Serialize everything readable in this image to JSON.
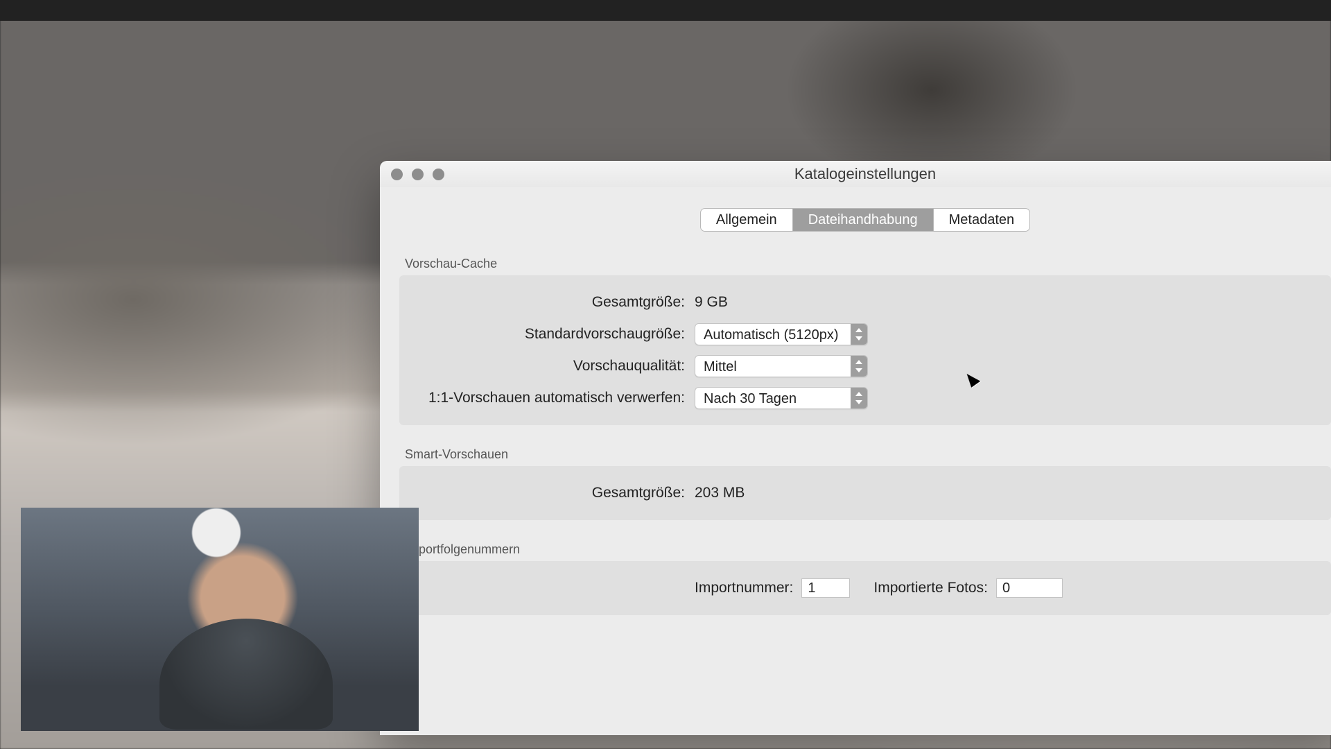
{
  "window": {
    "title": "Katalogeinstellungen"
  },
  "tabs": {
    "general": "Allgemein",
    "file": "Dateihandhabung",
    "metadata": "Metadaten",
    "active": "file"
  },
  "preview_cache": {
    "section_label": "Vorschau-Cache",
    "total_size_label": "Gesamtgröße:",
    "total_size_value": "9 GB",
    "default_size_label": "Standardvorschaugröße:",
    "default_size_value": "Automatisch (5120px)",
    "quality_label": "Vorschauqualität:",
    "quality_value": "Mittel",
    "discard_label": "1:1-Vorschauen automatisch verwerfen:",
    "discard_value": "Nach 30 Tagen"
  },
  "smart_previews": {
    "section_label": "Smart-Vorschauen",
    "total_size_label": "Gesamtgröße:",
    "total_size_value": "203 MB"
  },
  "import_numbers": {
    "section_label": "Importfolgenummern",
    "import_number_label": "Importnummer:",
    "import_number_value": "1",
    "imported_photos_label": "Importierte Fotos:",
    "imported_photos_value": "0"
  }
}
